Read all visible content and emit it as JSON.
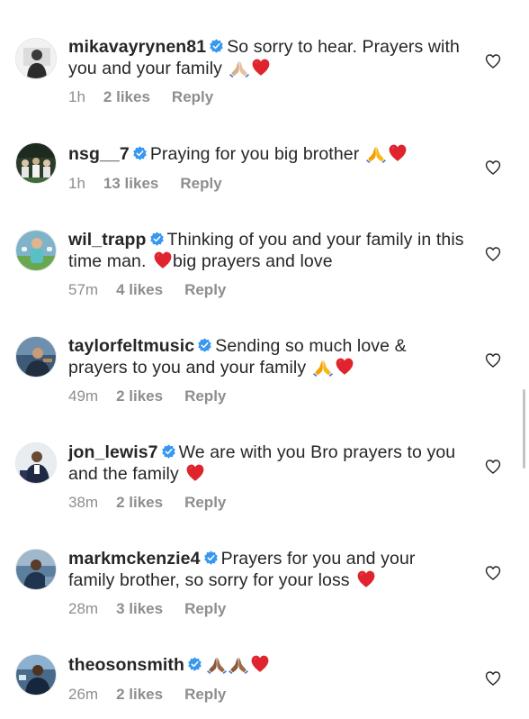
{
  "colors": {
    "text": "#262626",
    "muted": "#8e8e8e",
    "verified": "#3897f0",
    "heart": "#ed4956"
  },
  "icons": {
    "verified": "verified-badge-icon",
    "like": "heart-outline-icon",
    "pray_light": "folded-hands-light-skin-emoji",
    "pray": "folded-hands-emoji",
    "pray_dark": "folded-hands-dark-skin-emoji",
    "heart": "red-heart-emoji"
  },
  "comments": [
    {
      "username": "mikavayrynen81",
      "text": "So sorry to hear. Prayers with you and your family",
      "emojis": [
        "folded-hands-light-skin-emoji",
        "red-heart-emoji"
      ],
      "time": "1h",
      "likes": "2 likes",
      "reply": "Reply"
    },
    {
      "username": "nsg__7",
      "text": "Praying for you big brother",
      "emojis": [
        "folded-hands-emoji",
        "red-heart-emoji"
      ],
      "time": "1h",
      "likes": "13 likes",
      "reply": "Reply"
    },
    {
      "username": "wil_trapp",
      "text_before": "Thinking of you and your family in this time man.",
      "text_after": "big prayers and love",
      "emojis": [
        "red-heart-emoji"
      ],
      "time": "57m",
      "likes": "4 likes",
      "reply": "Reply"
    },
    {
      "username": "taylorfeltmusic",
      "text": "Sending so much love & prayers to you and your family",
      "emojis": [
        "folded-hands-emoji",
        "red-heart-emoji"
      ],
      "time": "49m",
      "likes": "2 likes",
      "reply": "Reply"
    },
    {
      "username": "jon_lewis7",
      "text": "We are with you Bro prayers to you and the family",
      "emojis": [
        "red-heart-emoji"
      ],
      "time": "38m",
      "likes": "2 likes",
      "reply": "Reply"
    },
    {
      "username": "markmckenzie4",
      "text": "Prayers for you and your family brother, so sorry for your loss",
      "emojis": [
        "red-heart-emoji"
      ],
      "time": "28m",
      "likes": "3 likes",
      "reply": "Reply"
    },
    {
      "username": "theosonsmith",
      "text": "",
      "emojis": [
        "folded-hands-dark-skin-emoji",
        "folded-hands-dark-skin-emoji",
        "red-heart-emoji"
      ],
      "time": "26m",
      "likes": "2 likes",
      "reply": "Reply"
    }
  ]
}
